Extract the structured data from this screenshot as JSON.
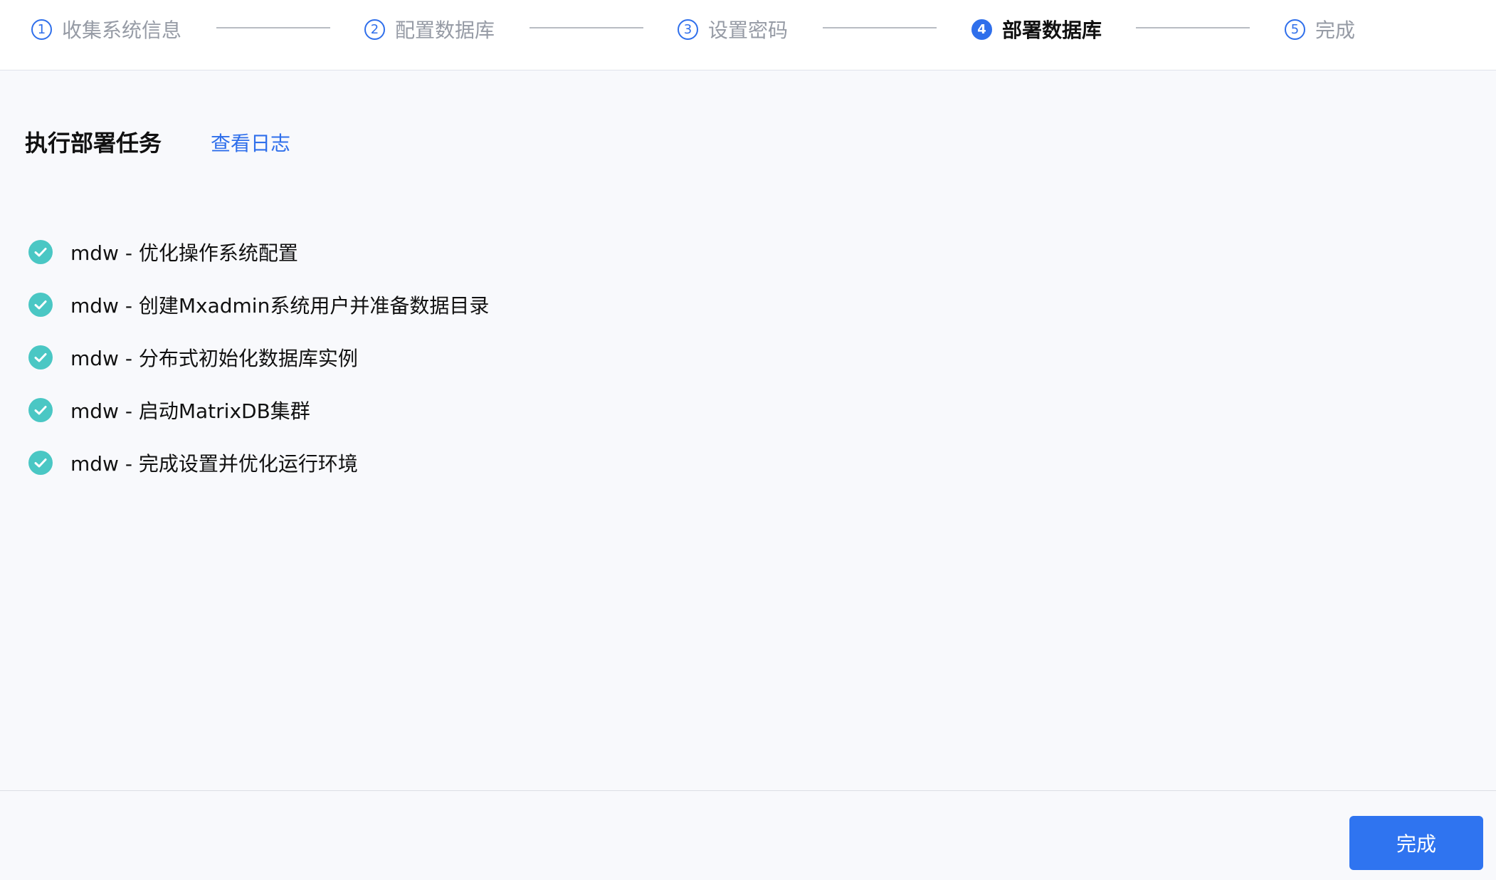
{
  "stepper": {
    "steps": [
      {
        "number": "1",
        "label": "收集系统信息",
        "state": "done"
      },
      {
        "number": "2",
        "label": "配置数据库",
        "state": "done"
      },
      {
        "number": "3",
        "label": "设置密码",
        "state": "done"
      },
      {
        "number": "4",
        "label": "部署数据库",
        "state": "active"
      },
      {
        "number": "5",
        "label": "完成",
        "state": "pending"
      }
    ]
  },
  "section": {
    "title": "执行部署任务",
    "log_link": "查看日志"
  },
  "tasks": [
    {
      "label": "mdw - 优化操作系统配置",
      "status": "done",
      "icon": "check-circle-icon"
    },
    {
      "label": "mdw - 创建Mxadmin系统用户并准备数据目录",
      "status": "done",
      "icon": "check-circle-icon"
    },
    {
      "label": "mdw - 分布式初始化数据库实例",
      "status": "done",
      "icon": "check-circle-icon"
    },
    {
      "label": "mdw - 启动MatrixDB集群",
      "status": "done",
      "icon": "check-circle-icon"
    },
    {
      "label": "mdw - 完成设置并优化运行环境",
      "status": "done",
      "icon": "check-circle-icon"
    }
  ],
  "footer": {
    "done_button": "完成"
  },
  "colors": {
    "accent": "#2f6feb",
    "success": "#4ac7c4",
    "background": "#f8f9fc"
  }
}
